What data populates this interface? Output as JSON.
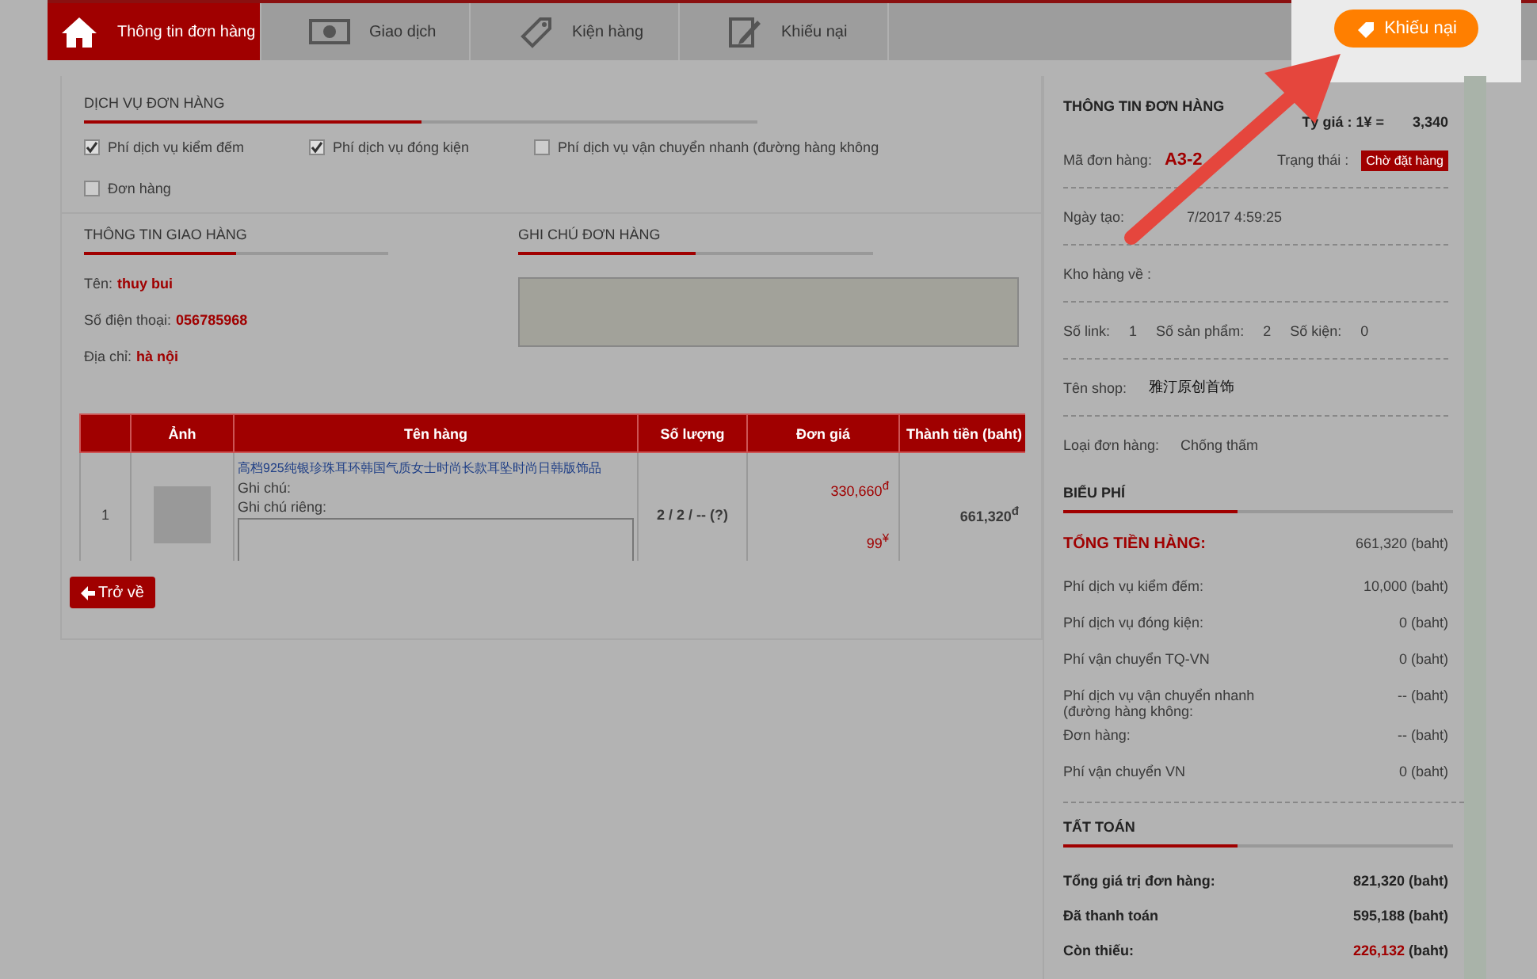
{
  "tabs": [
    {
      "label": "Thông tin đơn hàng",
      "selected": true
    },
    {
      "label": "Giao dịch",
      "selected": false
    },
    {
      "label": "Kiện hàng",
      "selected": false
    },
    {
      "label": "Khiếu nại",
      "selected": false
    }
  ],
  "complaint_button": {
    "label": "Khiếu nại"
  },
  "services": {
    "title": "DỊCH VỤ ĐƠN HÀNG",
    "options": [
      {
        "label": "Phí dịch vụ kiểm đếm",
        "checked": true
      },
      {
        "label": "Phí dịch vụ đóng kiện",
        "checked": true
      },
      {
        "label": "Phí dịch vụ vận chuyển nhanh (đường hàng không",
        "checked": false
      },
      {
        "label": "Đơn hàng",
        "checked": false
      }
    ]
  },
  "delivery": {
    "title": "THÔNG TIN GIAO HÀNG",
    "fields": [
      {
        "label": "Tên:",
        "value": "thuy bui"
      },
      {
        "label": "Số điện thoại:",
        "value": "056785968"
      },
      {
        "label": "Địa chỉ:",
        "value": "hà nội"
      }
    ]
  },
  "order_note": {
    "title": "GHI CHÚ ĐƠN HÀNG"
  },
  "table": {
    "columns": [
      "Ảnh",
      "Tên hàng",
      "Số lượng",
      "Đơn giá",
      "Thành tiền (baht)"
    ],
    "rows": [
      {
        "index": "1",
        "name": "高档925纯银珍珠耳环韩国气质女士时尚长款耳坠时尚日韩版饰品",
        "note_label": "Ghi chú:",
        "private_note_label": "Ghi chú riêng:",
        "quantity": "2 / 2 / --  (?)",
        "price_local": "330,660$^{đ}$",
        "price_cny": "99$^{¥}$",
        "total": "661,320$^{đ}$"
      }
    ]
  },
  "back_button": {
    "label": "Trở về"
  },
  "order_info": {
    "title": "THÔNG TIN ĐƠN HÀNG",
    "rate_label": "Tỷ giá : 1¥ =",
    "rate_value": "3,340",
    "code_label": "Mã đơn hàng:",
    "code": "A3-2",
    "status_label": "Trạng thái :",
    "status": "Chờ đặt hàng",
    "created_label": "Ngày tạo:",
    "created": "7/2017 4:59:25",
    "warehouse_label": "Kho hàng về :",
    "counts": [
      {
        "label": "Số link:",
        "value": "1"
      },
      {
        "label": "Số sản phẩm:",
        "value": "2"
      },
      {
        "label": "Số kiện:",
        "value": "0"
      }
    ],
    "shop_label": "Tên shop:",
    "shop": "雅汀原创首饰",
    "type_label": "Loại đơn hàng:",
    "type": "Chống thấm"
  },
  "fees": {
    "title": "BIỂU PHÍ",
    "rows": [
      {
        "kind": "total",
        "label": "TỔNG TIỀN HÀNG:",
        "value": "661,320 (baht)"
      },
      {
        "kind": "item",
        "label": "Phí dịch vụ kiểm đếm:",
        "value": "10,000 (baht)"
      },
      {
        "kind": "item",
        "label": "Phí dịch vụ đóng kiện:",
        "value": "0 (baht)"
      },
      {
        "kind": "item",
        "label": "Phí vận chuyển TQ-VN",
        "value": "0 (baht)"
      },
      {
        "kind": "item",
        "label": "Phí dịch vụ vận chuyển nhanh (đường hàng không:",
        "value": "-- (baht)"
      },
      {
        "kind": "item",
        "label": "Đơn hàng:",
        "value": "-- (baht)"
      },
      {
        "kind": "item",
        "label": "Phí vận chuyển VN",
        "value": "0 (baht)"
      }
    ]
  },
  "settlement": {
    "title": "TẤT TOÁN",
    "rows": [
      {
        "label": "Tổng giá trị đơn hàng:",
        "amount": "821,320",
        "unit": "(baht)",
        "highlight": false
      },
      {
        "label": "Đã thanh toán",
        "amount": "595,188",
        "unit": "(baht)",
        "highlight": false
      },
      {
        "label": "Còn thiếu:",
        "amount": "226,132",
        "unit": "(baht)",
        "highlight": true
      }
    ]
  }
}
